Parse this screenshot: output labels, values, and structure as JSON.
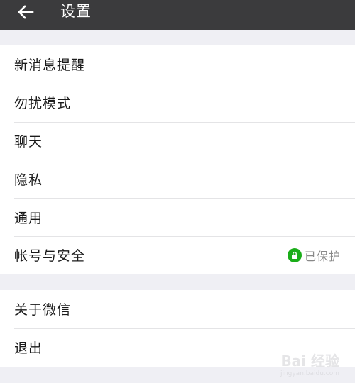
{
  "header": {
    "title": "设置"
  },
  "groups": [
    {
      "items": [
        {
          "label": "新消息提醒"
        },
        {
          "label": "勿扰模式"
        },
        {
          "label": "聊天"
        },
        {
          "label": "隐私"
        },
        {
          "label": "通用"
        },
        {
          "label": "帐号与安全",
          "status": "已保护",
          "status_icon": "lock-icon",
          "status_color": "#1aad19"
        }
      ]
    },
    {
      "items": [
        {
          "label": "关于微信"
        },
        {
          "label": "退出"
        }
      ]
    }
  ],
  "watermark": {
    "text": "Bai 经验",
    "sub": "jingyan.baidu.com"
  },
  "colors": {
    "header_bg": "#3b3b3d",
    "page_bg": "#efeff4",
    "accent_green": "#1aad19"
  }
}
